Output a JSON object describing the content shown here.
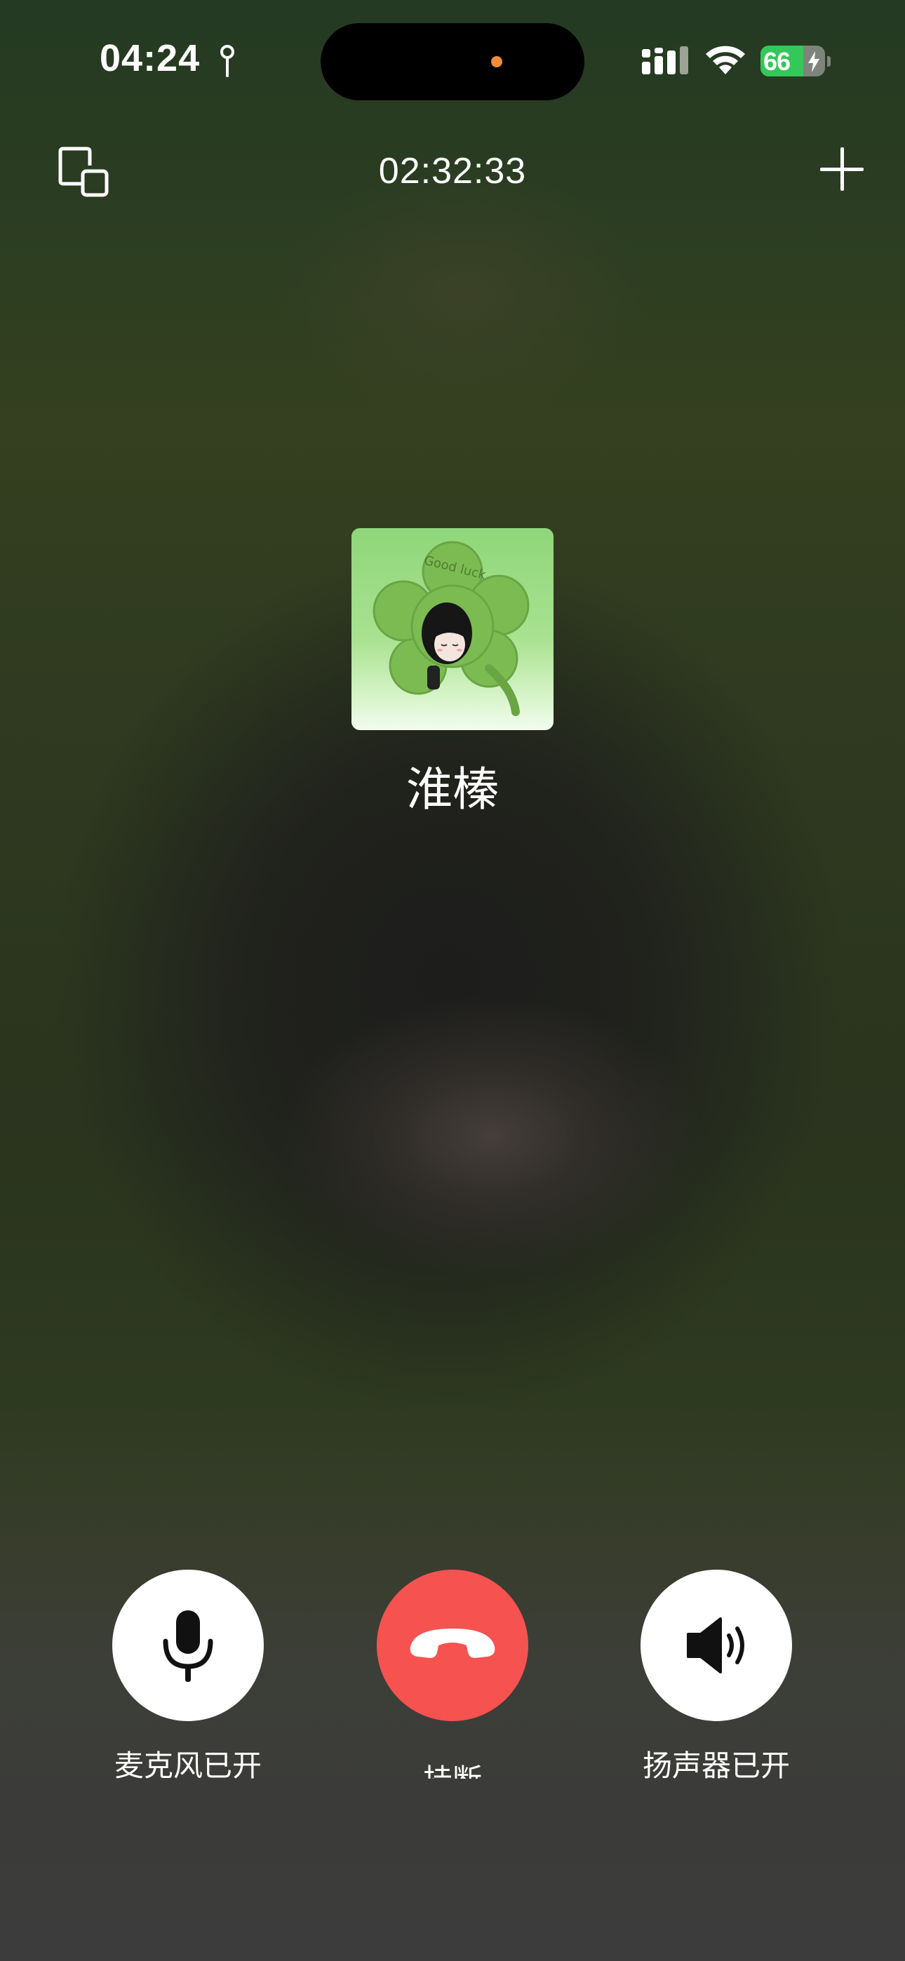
{
  "status_bar": {
    "time": "04:24",
    "battery_level": "66",
    "battery_fraction": 0.66,
    "location_icon": "location-pin-icon",
    "signal_icon": "cellular-signal-icon",
    "wifi_icon": "wifi-icon",
    "charging_icon": "charging-bolt-icon"
  },
  "call": {
    "duration": "02:32:33",
    "contact_name": "淮榛",
    "avatar": {
      "icon": "clover-flower-avatar",
      "text": "Good luck"
    }
  },
  "top_controls": {
    "minimize_icon": "floating-window-icon",
    "add_icon": "plus-icon"
  },
  "controls": {
    "mic": {
      "label": "麦克风已开",
      "icon": "microphone-icon"
    },
    "hangup": {
      "label": "挂断",
      "icon": "hangup-phone-icon",
      "color": "#f65250"
    },
    "speaker": {
      "label": "扬声器已开",
      "icon": "speaker-icon"
    }
  },
  "colors": {
    "background_top": "#243a22",
    "background_bottom": "#3c3c3c",
    "battery_fill": "#34c759",
    "island_dot": "#f08c3a"
  }
}
